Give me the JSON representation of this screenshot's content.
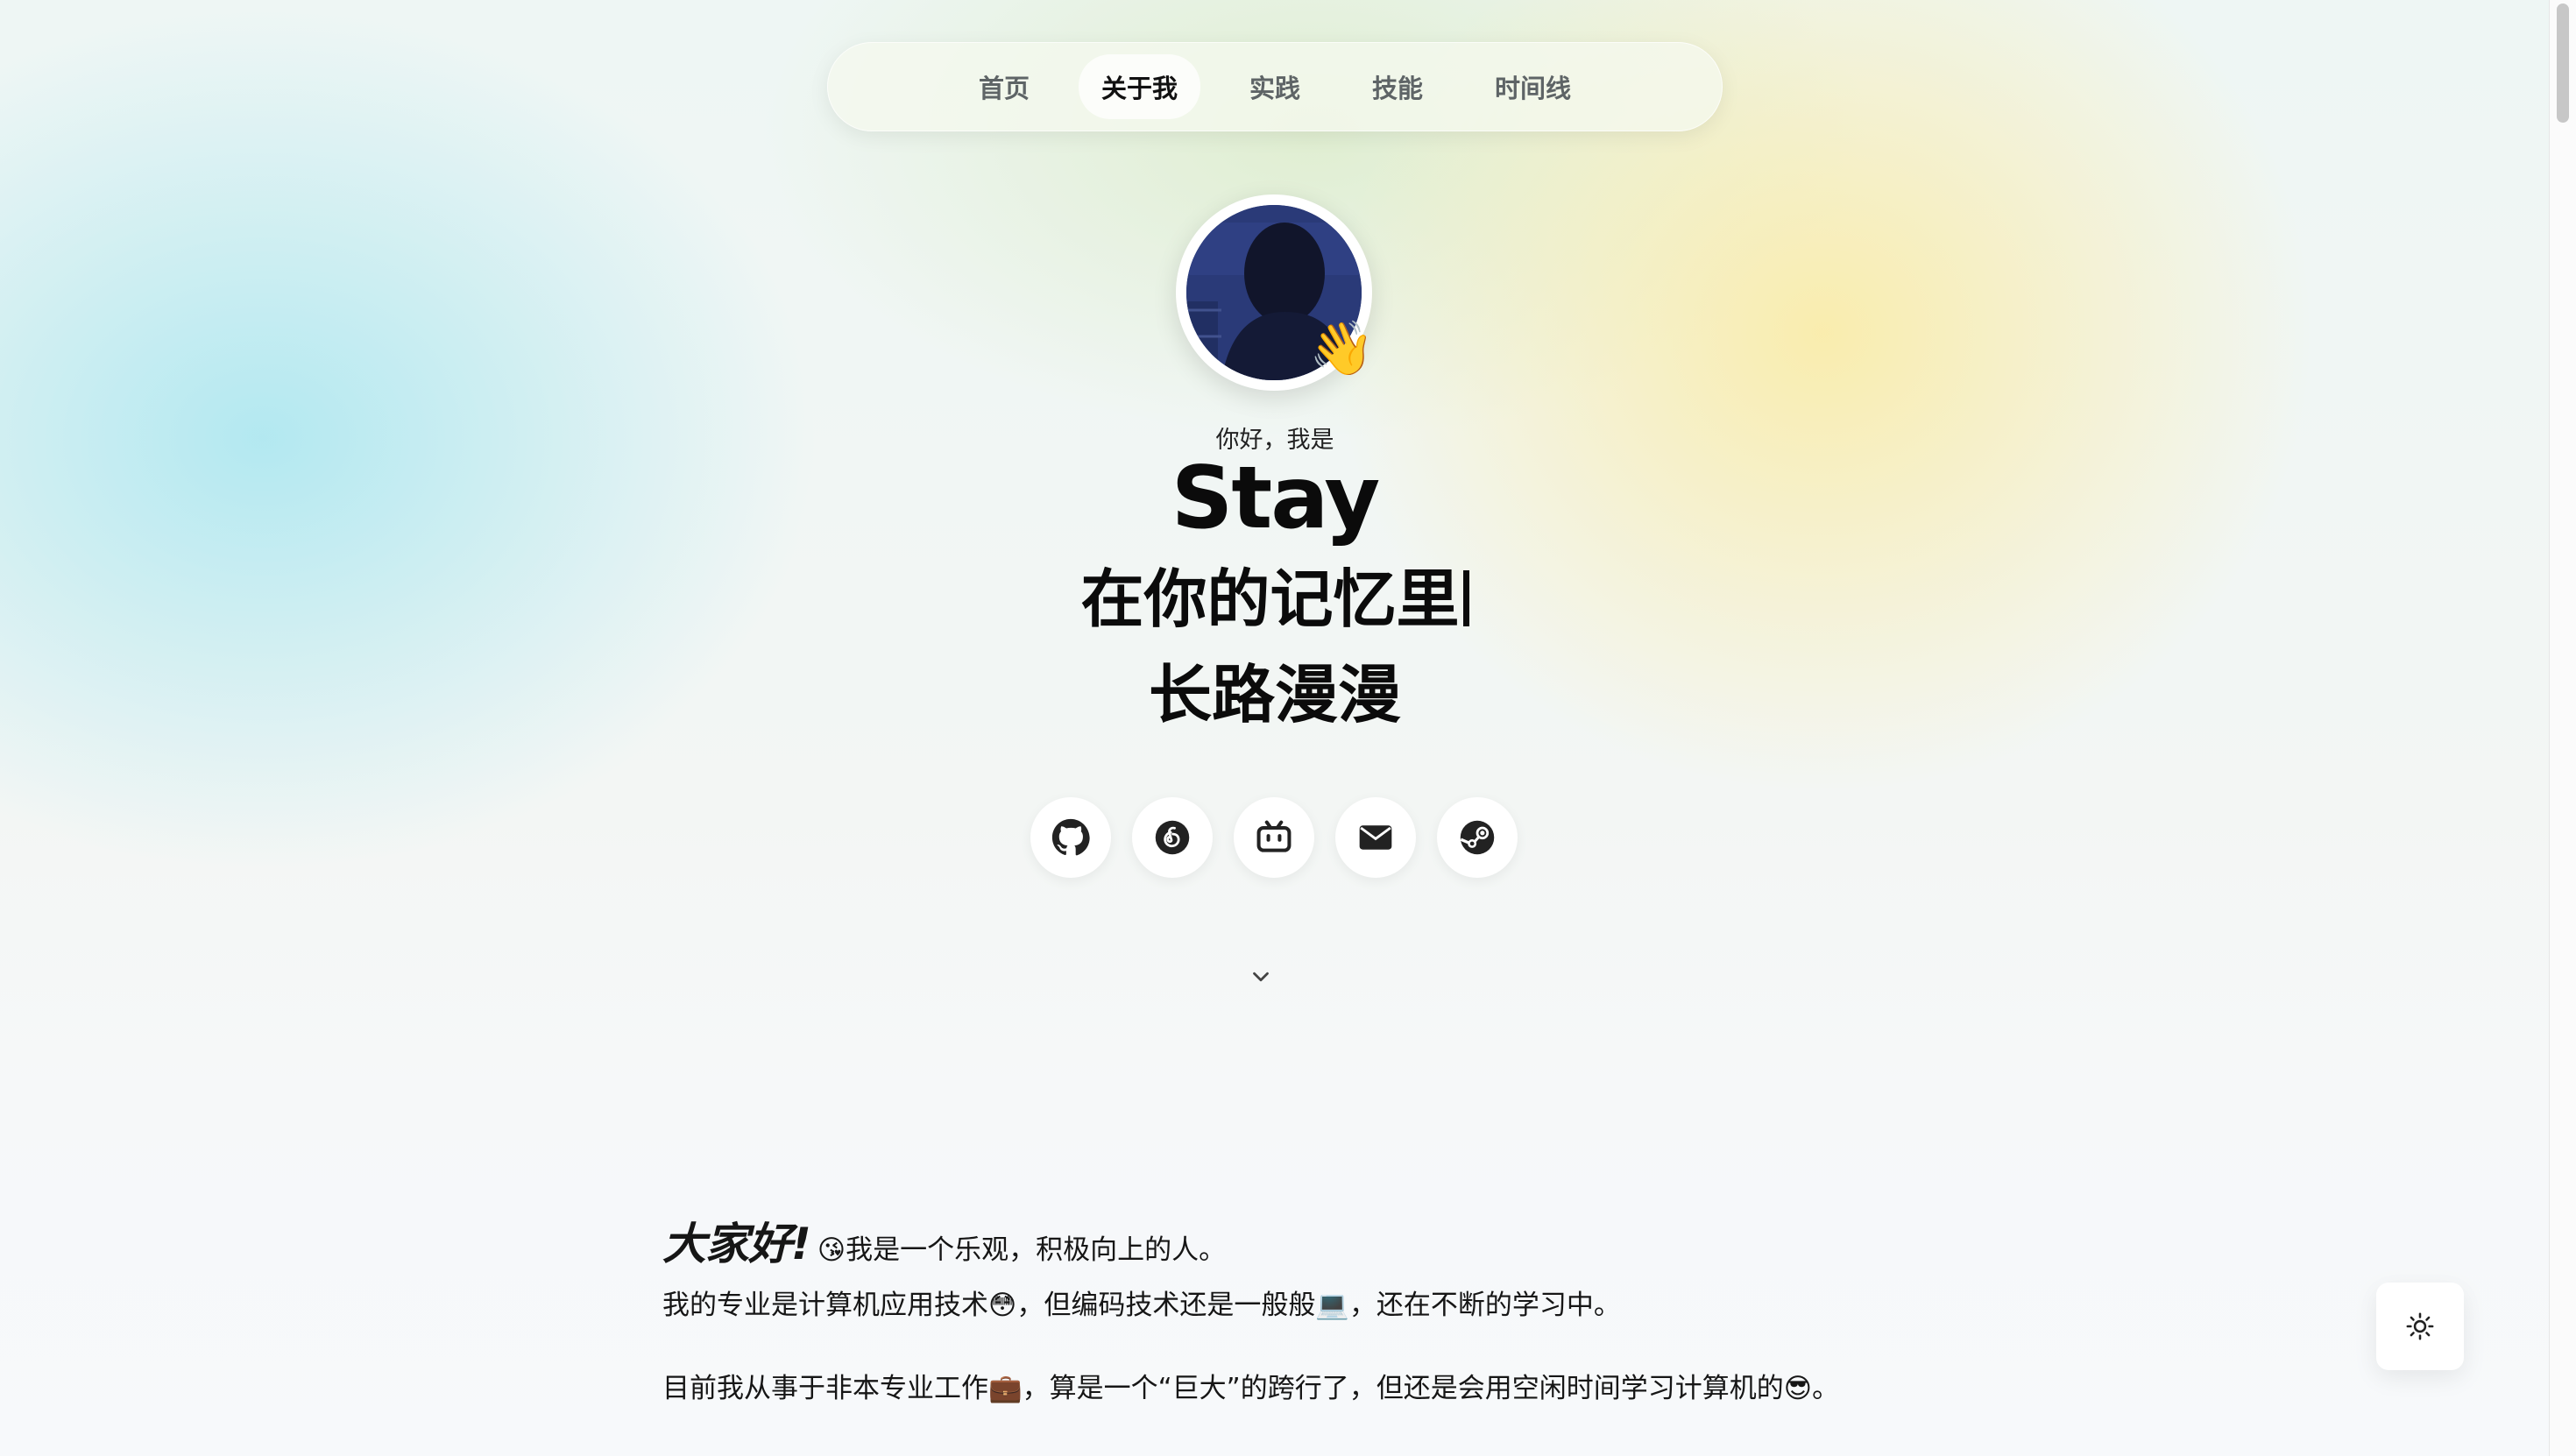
{
  "nav": {
    "items": [
      {
        "label": "首页"
      },
      {
        "label": "关于我"
      },
      {
        "label": "实践"
      },
      {
        "label": "技能"
      },
      {
        "label": "时间线"
      }
    ],
    "active_label": "关于我"
  },
  "hero": {
    "greeting": "你好，我是",
    "name": "Stay",
    "typed_text": "在你的记忆里",
    "motto": "长路漫漫",
    "avatar_badge": "👋"
  },
  "socials": [
    {
      "icon": "github-icon"
    },
    {
      "icon": "netease-music-icon"
    },
    {
      "icon": "bilibili-icon"
    },
    {
      "icon": "email-icon"
    },
    {
      "icon": "steam-icon"
    }
  ],
  "intro": {
    "hello": "大家好!",
    "line1_emoji": "😘",
    "line1": "我是一个乐观，积极向上的人。",
    "line2_a": "我的专业是计算机应用技术",
    "line2_emoji_a": "😳",
    "line2_b": "，但编码技术还是一般般",
    "line2_emoji_b": "💻",
    "line2_c": "，还在不断的学习中。",
    "line3_a": "目前我从事于非本专业工作",
    "line3_emoji_a": "💼",
    "line3_b": "，算是一个“巨大”的跨行了，但还是会用空闲时间学习计算机的",
    "line3_emoji_b": "😎",
    "line3_c": "。"
  },
  "icons": {
    "scroll_down": "chevron-down-icon",
    "theme_toggle": "sun-icon"
  },
  "colors": {
    "accent_text": "#111111",
    "nav_inactive": "#5e6466"
  }
}
